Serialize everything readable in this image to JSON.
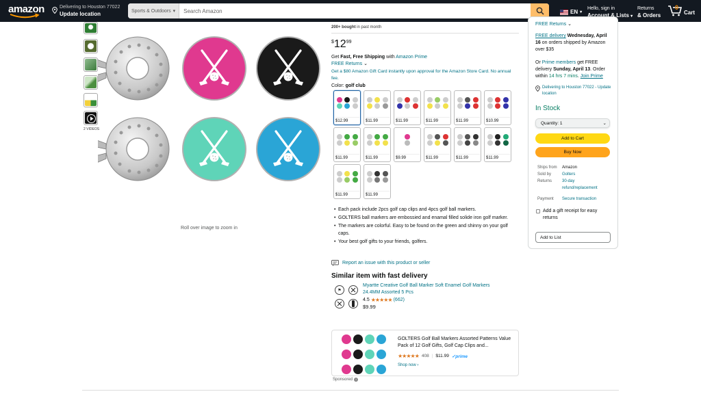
{
  "nav": {
    "logo": "amazon",
    "deliver_line1": "Delivering to Houston 77022",
    "deliver_line2": "Update location",
    "search_category": "Sports & Outdoors",
    "search_placeholder": "Search Amazon",
    "lang": "EN",
    "account_line1": "Hello, sign in",
    "account_line2": "Account & Lists",
    "orders_line1": "Returns",
    "orders_line2": "& Orders",
    "cart_count": "0",
    "cart_label": "Cart"
  },
  "gallery": {
    "videos_label": "2 VIDEOS",
    "zoom_hint": "Roll over image to zoom in"
  },
  "product": {
    "bought_bold": "200+ bought",
    "bought_rest": " in past month",
    "price_symbol": "$",
    "price_whole": "12",
    "price_fraction": "99",
    "shipping_prefix": "Get ",
    "shipping_bold": "Fast, Free Shipping",
    "shipping_with": " with ",
    "shipping_link": "Amazon Prime",
    "free_returns": "FREE Returns",
    "promo": "Get a $80 Amazon Gift Card instantly upon approval for the Amazon Store Card. No annual fee.",
    "color_label": "Color: ",
    "color_value": "golf club",
    "swatch_prices": [
      "$12.99",
      "$11.99",
      "$11.99",
      "$11.99",
      "$11.99",
      "$10.99",
      "$11.99",
      "$11.99",
      "$9.99",
      "$11.99",
      "$11.99",
      "$11.99",
      "$11.99",
      "$11.99"
    ],
    "bullets": [
      "Each pack include 2pcs golf cap clips and 4pcs golf ball markers.",
      "GOLTERS ball markers are embossied and enamal filled solide iron golf marker.",
      "The markers are colorful. Easy to be found on the green and shinny on your golf caps.",
      "Your best golf gifts to your friends, golfers."
    ],
    "report": "Report an issue with this product or seller"
  },
  "similar": {
    "heading": "Similar item with fast delivery",
    "title": "Myartte Creative Golf Ball Marker Soft Enamel Golf Markers 24.4MM Assorted 5 Pcs",
    "rating": "4.5",
    "reviews": "(662)",
    "price": "$9.99"
  },
  "sponsored": {
    "title": "GOLTERS Golf Ball Markers Assorted Patterns Value Pack of 12 Golf Gifts, Golf Cap Clips and...",
    "reviews": "408",
    "price": "$11.99",
    "prime": "prime",
    "shop_now": "Shop now ›",
    "label": "Sponsored"
  },
  "buybox": {
    "free_returns": "FREE Returns",
    "free_delivery": "FREE delivery",
    "delivery_date": " Wednesday, April 16",
    "delivery_rest": " on orders shipped by Amazon over $35",
    "or": "Or ",
    "prime_members": "Prime members",
    "fastest_text": " get FREE delivery ",
    "fastest_date": "Sunday, April 13",
    "order_within": ". Order within ",
    "countdown": "14 hrs 7 mins",
    "join_prime": "Join Prime",
    "deliver_to": "Delivering to Houston 77022 - Update location",
    "in_stock": "In Stock",
    "quantity": "Quantity: 1",
    "add_to_cart": "Add to Cart",
    "buy_now": "Buy Now",
    "ships_from_label": "Ships from",
    "ships_from": "Amazon",
    "sold_by_label": "Sold by",
    "sold_by": "Golters",
    "returns_label": "Returns",
    "returns": "30-day refund/replacement",
    "payment_label": "Payment",
    "payment": "Secure transaction",
    "gift_receipt": "Add a gift receipt for easy returns",
    "add_to_list": "Add to List"
  },
  "colors": {
    "nav_bg": "#131921",
    "search_button": "#febd69",
    "link": "#007185",
    "in_stock": "#067d62",
    "add_to_cart": "#ffd814",
    "buy_now": "#ffa41c",
    "pink": "#e0398f",
    "black": "#1a1a1a",
    "mint": "#5fd4b8",
    "blue": "#2aa5d6"
  }
}
